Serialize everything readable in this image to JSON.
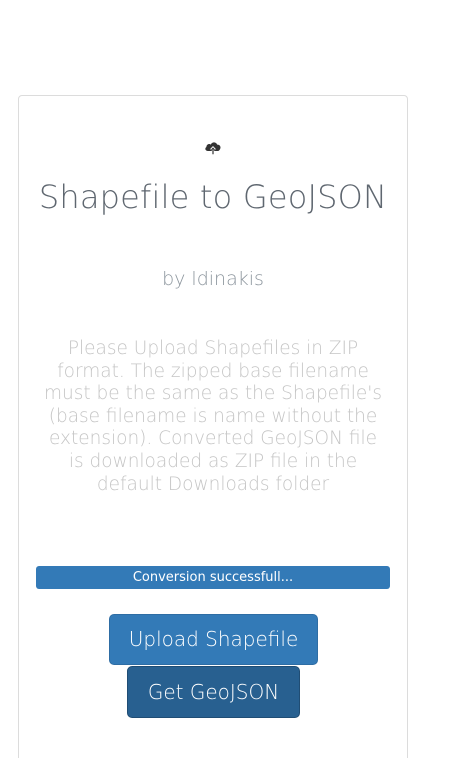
{
  "header": {
    "title": "Shapefile to GeoJSON",
    "author": "by ldinakis",
    "icon": "cloud-upload-icon"
  },
  "instructions": {
    "text": "Please Upload Shapefiles in ZIP format. The zipped base filename must be the same as the Shapefile's (base filename is name without the extension). Converted GeoJSON file is downloaded as ZIP file in the default Downloads folder"
  },
  "status": {
    "message": "Conversion successfull...",
    "progress": 1.0
  },
  "actions": {
    "upload_label": "Upload Shapefile",
    "get_label": "Get GeoJSON"
  },
  "colors": {
    "primary": "#337ab7",
    "primary_dark": "#286090",
    "title_text": "#5f6770",
    "muted_text": "#c5c5c5"
  }
}
